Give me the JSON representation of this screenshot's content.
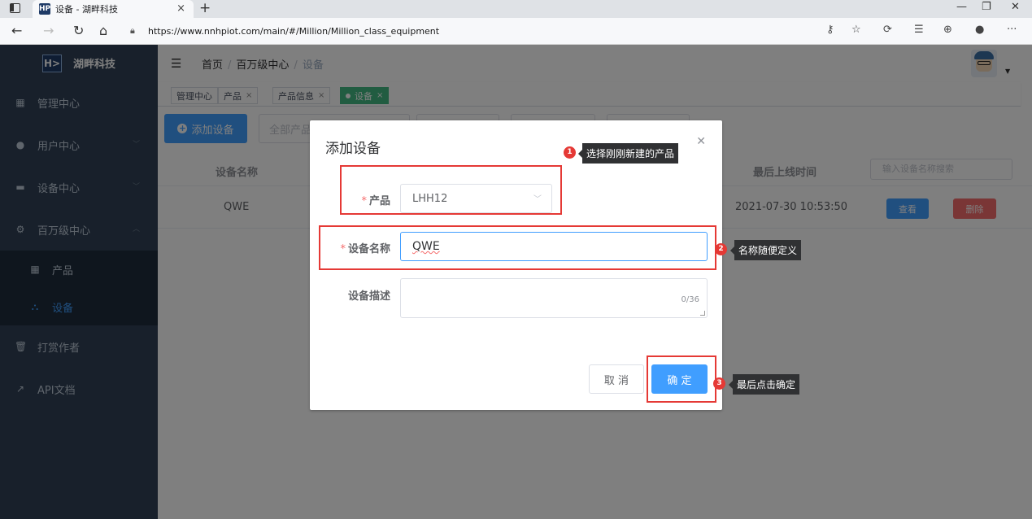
{
  "browser": {
    "tab_title": "设备 - 湖畔科技",
    "favicon_text": "HP",
    "url": "https://www.nnhpiot.com/main/#/Million/Million_class_equipment"
  },
  "sidebar": {
    "brand": "湖畔科技",
    "logo_text": "H>",
    "items": [
      {
        "label": "管理中心",
        "icon": "grid-icon"
      },
      {
        "label": "用户中心",
        "icon": "user-icon"
      },
      {
        "label": "设备中心",
        "icon": "monitor-icon"
      },
      {
        "label": "百万级中心",
        "icon": "chip-icon"
      }
    ],
    "sub_items": [
      {
        "label": "产品",
        "icon": "table-icon"
      },
      {
        "label": "设备",
        "icon": "sitemap-icon"
      }
    ],
    "bottom_items": [
      {
        "label": "打赏作者",
        "icon": "trash-icon"
      },
      {
        "label": "API文档",
        "icon": "external-link-icon"
      }
    ]
  },
  "header": {
    "breadcrumb": [
      "首页",
      "百万级中心",
      "设备"
    ]
  },
  "tags": [
    {
      "label": "管理中心"
    },
    {
      "label": "产品"
    },
    {
      "label": "产品信息"
    },
    {
      "label": "设备"
    }
  ],
  "toolbar": {
    "add_button": "添加设备",
    "filter_placeholder": "全部产品"
  },
  "table": {
    "columns": [
      "设备名称",
      "最后上线时间"
    ],
    "search_placeholder": "输入设备名称搜索",
    "rows": [
      {
        "name": "QWE",
        "last_online": "2021-07-30 10:53:50",
        "view": "查看",
        "delete": "删除"
      }
    ]
  },
  "dialog": {
    "title": "添加设备",
    "product_label": "产品",
    "product_value": "LHH12",
    "name_label": "设备名称",
    "name_value": "QWE",
    "desc_label": "设备描述",
    "desc_counter": "0/36",
    "cancel": "取 消",
    "confirm": "确 定"
  },
  "annotations": [
    {
      "num": "1",
      "text": "选择刚刚新建的产品"
    },
    {
      "num": "2",
      "text": "名称随便定义"
    },
    {
      "num": "3",
      "text": "最后点击确定"
    }
  ],
  "colors": {
    "primary": "#409eff",
    "sidebar": "#304156",
    "annotation": "#e53935",
    "tag_active": "#42b983"
  }
}
